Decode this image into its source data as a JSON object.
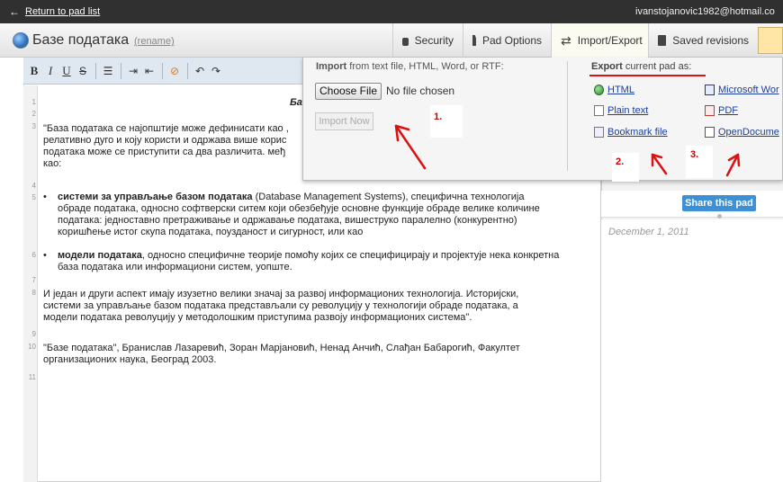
{
  "topbar": {
    "back_link": "Return to pad list",
    "user_email": "ivanstojanovic1982@hotmail.co"
  },
  "pad": {
    "title": "Базе података",
    "rename_label": "(rename)"
  },
  "tabs": [
    {
      "label": "Security",
      "icon": "lock-icon"
    },
    {
      "label": "Pad Options",
      "icon": "document-icon"
    },
    {
      "label": "Import/Export",
      "icon": "swap-arrows-icon"
    },
    {
      "label": "Saved revisions",
      "icon": "floppy-disk-icon"
    }
  ],
  "toolbar": {
    "bold": "B",
    "italic": "I",
    "underline": "U",
    "strikethrough": "S"
  },
  "import_panel": {
    "label_bold": "Import",
    "label_rest": " from text file, HTML, Word, or RTF:",
    "choose_file": "Choose File",
    "no_file": "No file chosen",
    "import_now": "Import Now"
  },
  "export_panel": {
    "label_bold": "Export",
    "label_rest": " current pad as:",
    "formats": {
      "html": "HTML",
      "plain": "Plain text",
      "bookmark": "Bookmark file",
      "word": "Microsoft Wor",
      "pdf": "PDF",
      "odt": "OpenDocume"
    }
  },
  "annotations": [
    "1.",
    "2.",
    "3."
  ],
  "sidebar": {
    "share_button": "Share this pad",
    "date": "December 1, 2011"
  },
  "line_numbers": [
    "1",
    "2",
    "3",
    "4",
    "5",
    "6",
    "7",
    "8",
    "9",
    "10",
    "11"
  ],
  "document": {
    "line1_heading": "Ба",
    "p1": [
      "\"База података се најопштије може дефинисати као ,",
      "релативно дуго и коју користи и одржава више корис",
      "података може се приступити са два различита. међ",
      "као:"
    ],
    "b1_bold": "системи за управљање базом података",
    "b1_rest": " (Database Management Systems), специфична технологија",
    "b1_lines": [
      "обраде података, односно софтверски ситем који обезбеђује основне функције обраде велике количине",
      "података: једноставно претраживање и одржавање података, вишеструко паралелно (конкурентно)",
      "коришћење истог скупа података, поузданост и сигурност, или као"
    ],
    "b2_bold": "модели података",
    "b2_rest": ", односно специфичне теорије помоћу којих се специфицирају и пројектује нека конкретна",
    "b2_lines": [
      "база података или информациони систем, уопште."
    ],
    "p2": [
      "И један и други аспект имају изузетно велики значај за развој информационих технологија. Историјски,",
      "системи за управљање базом података представљали су револуцију у технологији обраде података, а",
      "модели података револуцију у методолошким приступима развоју информационих система\"."
    ],
    "p3": [
      "\"Базе података\", Бранислав Лазаревић, Зоран Марјановић, Ненад Анчић, Слађан Бабарогић, Факултет",
      "организационих наука, Београд 2003."
    ]
  }
}
